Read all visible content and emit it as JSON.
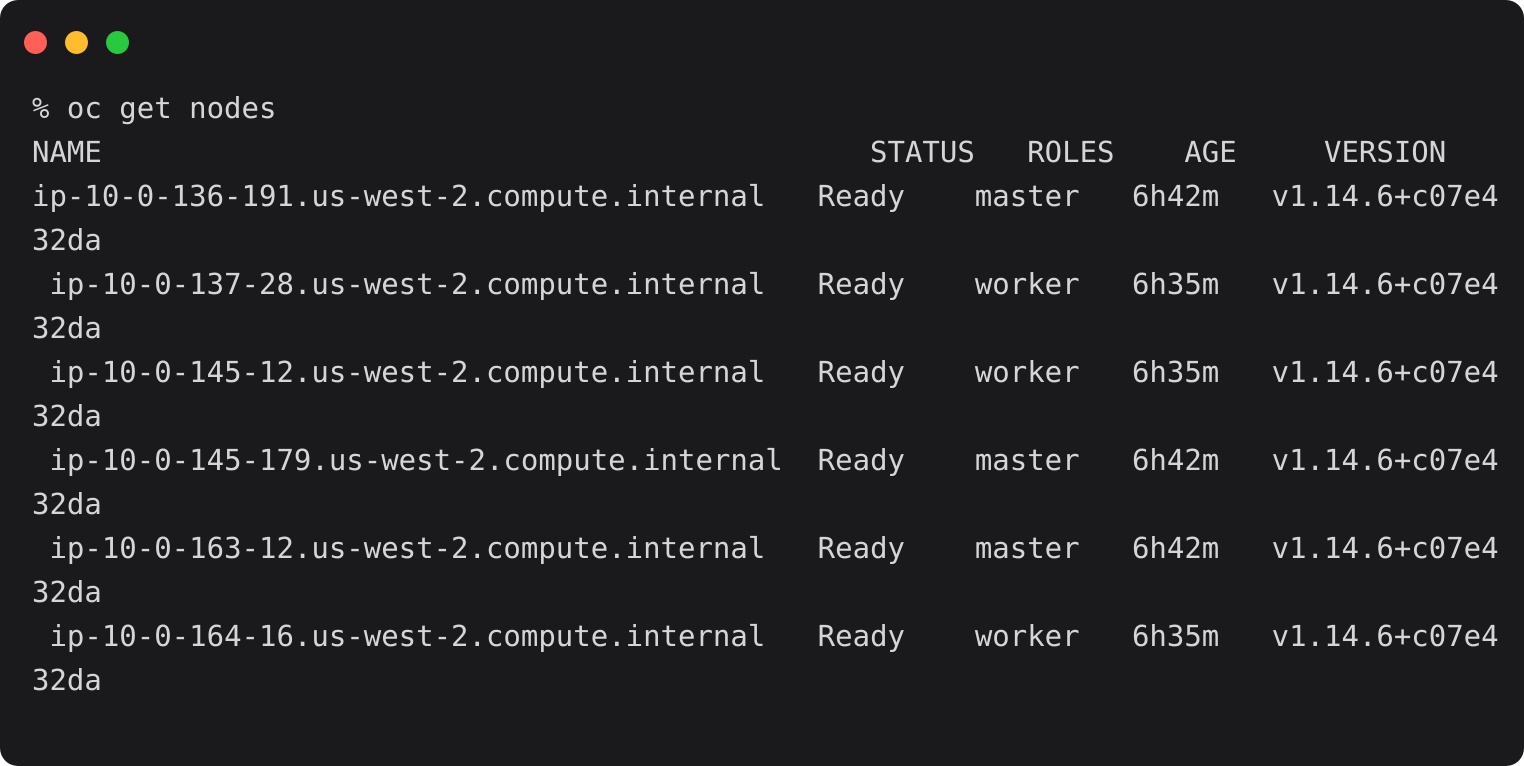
{
  "window": {
    "kind": "terminal-window",
    "title": "",
    "background_color": "#1a1a1c",
    "text_color": "#d5d5d7",
    "page_background": "#ffffff",
    "controls": [
      {
        "name": "close",
        "color": "#ff5f56"
      },
      {
        "name": "minimize",
        "color": "#ffbd2e"
      },
      {
        "name": "zoom",
        "color": "#27c93f"
      }
    ]
  },
  "terminal": {
    "prompt_symbol": "%",
    "command": "oc get nodes",
    "prompt_line": "% oc get nodes",
    "columns": [
      "NAME",
      "STATUS",
      "ROLES",
      "AGE",
      "VERSION"
    ],
    "header_line": "NAME                                            STATUS   ROLES    AGE     VERSION",
    "rows": [
      {
        "name": "ip-10-0-136-191.us-west-2.compute.internal",
        "status": "Ready",
        "roles": "master",
        "age": "6h42m",
        "version": "v1.14.6+c07e432da",
        "line": "ip-10-0-136-191.us-west-2.compute.internal   Ready    master   6h42m   v1.14.6+c07e432da"
      },
      {
        "name": "ip-10-0-137-28.us-west-2.compute.internal",
        "status": "Ready",
        "roles": "worker",
        "age": "6h35m",
        "version": "v1.14.6+c07e432da",
        "line": " ip-10-0-137-28.us-west-2.compute.internal   Ready    worker   6h35m   v1.14.6+c07e432da"
      },
      {
        "name": "ip-10-0-145-12.us-west-2.compute.internal",
        "status": "Ready",
        "roles": "worker",
        "age": "6h35m",
        "version": "v1.14.6+c07e432da",
        "line": " ip-10-0-145-12.us-west-2.compute.internal   Ready    worker   6h35m   v1.14.6+c07e432da"
      },
      {
        "name": "ip-10-0-145-179.us-west-2.compute.internal",
        "status": "Ready",
        "roles": "master",
        "age": "6h42m",
        "version": "v1.14.6+c07e432da",
        "line": " ip-10-0-145-179.us-west-2.compute.internal  Ready    master   6h42m   v1.14.6+c07e432da"
      },
      {
        "name": "ip-10-0-163-12.us-west-2.compute.internal",
        "status": "Ready",
        "roles": "master",
        "age": "6h42m",
        "version": "v1.14.6+c07e432da",
        "line": " ip-10-0-163-12.us-west-2.compute.internal   Ready    master   6h42m   v1.14.6+c07e432da"
      },
      {
        "name": "ip-10-0-164-16.us-west-2.compute.internal",
        "status": "Ready",
        "roles": "worker",
        "age": "6h35m",
        "version": "v1.14.6+c07e432da",
        "line": " ip-10-0-164-16.us-west-2.compute.internal   Ready    worker   6h35m   v1.14.6+c07e432da"
      }
    ]
  }
}
